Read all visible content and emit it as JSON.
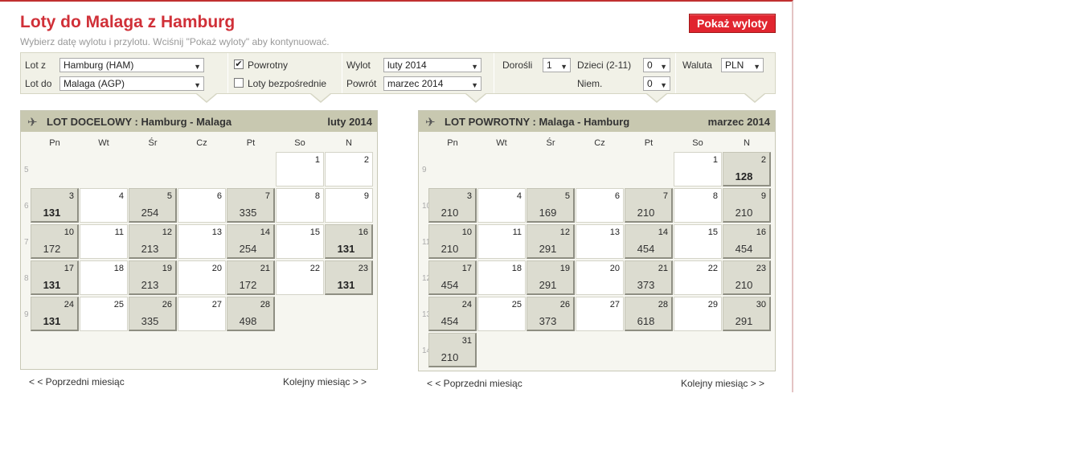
{
  "header": {
    "title": "Loty do Malaga z Hamburg",
    "subtitle": "Wybierz datę wylotu i przylotu. Wciśnij \"Pokaż wyloty\" aby kontynuować.",
    "show_button": "Pokaż wyloty"
  },
  "filters": {
    "from_label": "Lot z",
    "from_value": "Hamburg (HAM)",
    "to_label": "Lot do",
    "to_value": "Malaga (AGP)",
    "return_label": "Powrotny",
    "return_checked": true,
    "direct_label": "Loty bezpośrednie",
    "direct_checked": false,
    "depart_label": "Wylot",
    "depart_value": "luty 2014",
    "back_label": "Powrót",
    "back_value": "marzec 2014",
    "adults_label": "Dorośli",
    "adults_value": "1",
    "children_label": "Dzieci (2-11)",
    "children_value": "0",
    "infants_label": "Niem.",
    "infants_value": "0",
    "currency_label": "Waluta",
    "currency_value": "PLN"
  },
  "weekdays": [
    "Pn",
    "Wt",
    "Śr",
    "Cz",
    "Pt",
    "So",
    "N"
  ],
  "calendars": [
    {
      "title": "LOT DOCELOWY :  Hamburg - Malaga",
      "month": "luty 2014",
      "prev": "< < Poprzedni miesiąc",
      "next": "Kolejny miesiąc > >",
      "weeks": [
        {
          "num": "5",
          "days": [
            null,
            null,
            null,
            null,
            null,
            {
              "d": "1"
            },
            {
              "d": "2"
            }
          ]
        },
        {
          "num": "6",
          "days": [
            {
              "d": "3",
              "p": "131",
              "best": true
            },
            {
              "d": "4"
            },
            {
              "d": "5",
              "p": "254"
            },
            {
              "d": "6"
            },
            {
              "d": "7",
              "p": "335"
            },
            {
              "d": "8"
            },
            {
              "d": "9"
            }
          ]
        },
        {
          "num": "7",
          "days": [
            {
              "d": "10",
              "p": "172"
            },
            {
              "d": "11"
            },
            {
              "d": "12",
              "p": "213"
            },
            {
              "d": "13"
            },
            {
              "d": "14",
              "p": "254"
            },
            {
              "d": "15"
            },
            {
              "d": "16",
              "p": "131",
              "best": true
            }
          ]
        },
        {
          "num": "8",
          "days": [
            {
              "d": "17",
              "p": "131",
              "best": true
            },
            {
              "d": "18"
            },
            {
              "d": "19",
              "p": "213"
            },
            {
              "d": "20"
            },
            {
              "d": "21",
              "p": "172"
            },
            {
              "d": "22"
            },
            {
              "d": "23",
              "p": "131",
              "best": true
            }
          ]
        },
        {
          "num": "9",
          "days": [
            {
              "d": "24",
              "p": "131",
              "best": true
            },
            {
              "d": "25"
            },
            {
              "d": "26",
              "p": "335"
            },
            {
              "d": "27"
            },
            {
              "d": "28",
              "p": "498"
            },
            null,
            null
          ]
        }
      ]
    },
    {
      "title": "LOT POWROTNY :  Malaga - Hamburg",
      "month": "marzec 2014",
      "prev": "< < Poprzedni miesiąc",
      "next": "Kolejny miesiąc > >",
      "weeks": [
        {
          "num": "9",
          "days": [
            null,
            null,
            null,
            null,
            null,
            {
              "d": "1"
            },
            {
              "d": "2",
              "p": "128",
              "best": true
            }
          ]
        },
        {
          "num": "10",
          "days": [
            {
              "d": "3",
              "p": "210"
            },
            {
              "d": "4"
            },
            {
              "d": "5",
              "p": "169"
            },
            {
              "d": "6"
            },
            {
              "d": "7",
              "p": "210"
            },
            {
              "d": "8"
            },
            {
              "d": "9",
              "p": "210"
            }
          ]
        },
        {
          "num": "11",
          "days": [
            {
              "d": "10",
              "p": "210"
            },
            {
              "d": "11"
            },
            {
              "d": "12",
              "p": "291"
            },
            {
              "d": "13"
            },
            {
              "d": "14",
              "p": "454"
            },
            {
              "d": "15"
            },
            {
              "d": "16",
              "p": "454"
            }
          ]
        },
        {
          "num": "12",
          "days": [
            {
              "d": "17",
              "p": "454"
            },
            {
              "d": "18"
            },
            {
              "d": "19",
              "p": "291"
            },
            {
              "d": "20"
            },
            {
              "d": "21",
              "p": "373"
            },
            {
              "d": "22"
            },
            {
              "d": "23",
              "p": "210"
            }
          ]
        },
        {
          "num": "13",
          "days": [
            {
              "d": "24",
              "p": "454"
            },
            {
              "d": "25"
            },
            {
              "d": "26",
              "p": "373"
            },
            {
              "d": "27"
            },
            {
              "d": "28",
              "p": "618"
            },
            {
              "d": "29"
            },
            {
              "d": "30",
              "p": "291"
            }
          ]
        },
        {
          "num": "14",
          "days": [
            {
              "d": "31",
              "p": "210"
            },
            null,
            null,
            null,
            null,
            null,
            null
          ]
        }
      ]
    }
  ],
  "icons": {
    "plane": "airplane-icon",
    "dropdown": "chevron-down-icon",
    "checkbox": "checkbox-icon"
  }
}
